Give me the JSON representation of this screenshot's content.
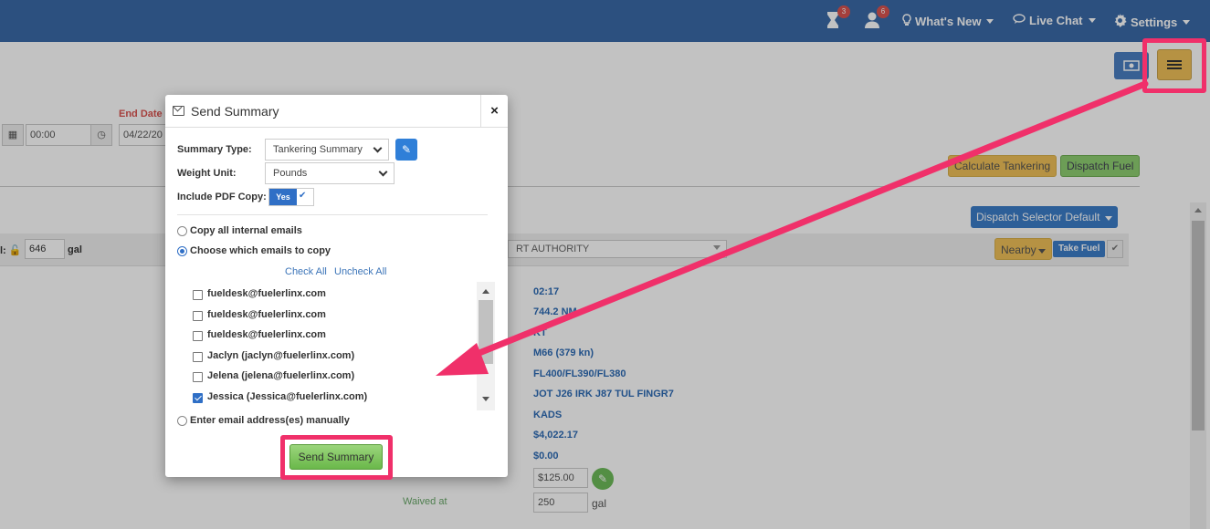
{
  "topnav": {
    "hourglass_badge": "3",
    "user_badge": "6",
    "whats_new": "What's New",
    "live_chat": "Live Chat",
    "settings": "Settings"
  },
  "background": {
    "end_date_label": "End Date",
    "time_value": "00:00",
    "end_date_value": "04/22/20",
    "calculate_tankering": "Calculate Tankering",
    "dispatch_fuel": "Dispatch Fuel",
    "dispatch_selector": "Dispatch Selector Default",
    "fuel_prefix": "l:",
    "fuel_value": "646",
    "fuel_unit": "gal",
    "authority_select": "RT AUTHORITY",
    "nearby": "Nearby",
    "take_fuel": "Take Fuel",
    "details": [
      "02:17",
      "744.2 NM",
      "KT",
      "M66 (379 kn)",
      "FL400/FL390/FL380",
      "JOT J26 IRK J87 TUL FINGR7",
      "KADS",
      "$4,022.17",
      "$0.00"
    ],
    "fee_value": "$125.00",
    "waived_label": "Waived at",
    "waived_value": "250",
    "waived_unit": "gal"
  },
  "modal": {
    "title": "Send Summary",
    "close": "×",
    "summary_type_label": "Summary Type:",
    "summary_type_value": "Tankering Summary",
    "weight_unit_label": "Weight Unit:",
    "weight_unit_value": "Pounds",
    "include_pdf_label": "Include PDF Copy:",
    "include_pdf_value": "Yes",
    "radio_copy_all": "Copy all internal emails",
    "radio_choose": "Choose which emails to copy",
    "check_all": "Check All",
    "uncheck_all": "Uncheck All",
    "emails": [
      {
        "label": "fueldesk@fuelerlinx.com",
        "checked": false
      },
      {
        "label": "fueldesk@fuelerlinx.com",
        "checked": false
      },
      {
        "label": "fueldesk@fuelerlinx.com",
        "checked": false
      },
      {
        "label": "Jaclyn (jaclyn@fuelerlinx.com)",
        "checked": false
      },
      {
        "label": "Jelena (jelena@fuelerlinx.com)",
        "checked": false
      },
      {
        "label": "Jessica (Jessica@fuelerlinx.com)",
        "checked": true
      }
    ],
    "radio_manual": "Enter email address(es) manually",
    "send_button": "Send Summary"
  },
  "colors": {
    "nav": "#3b6aa8",
    "highlight": "#f0306a",
    "primary": "#2f6fc6",
    "success": "#6ab84a"
  }
}
